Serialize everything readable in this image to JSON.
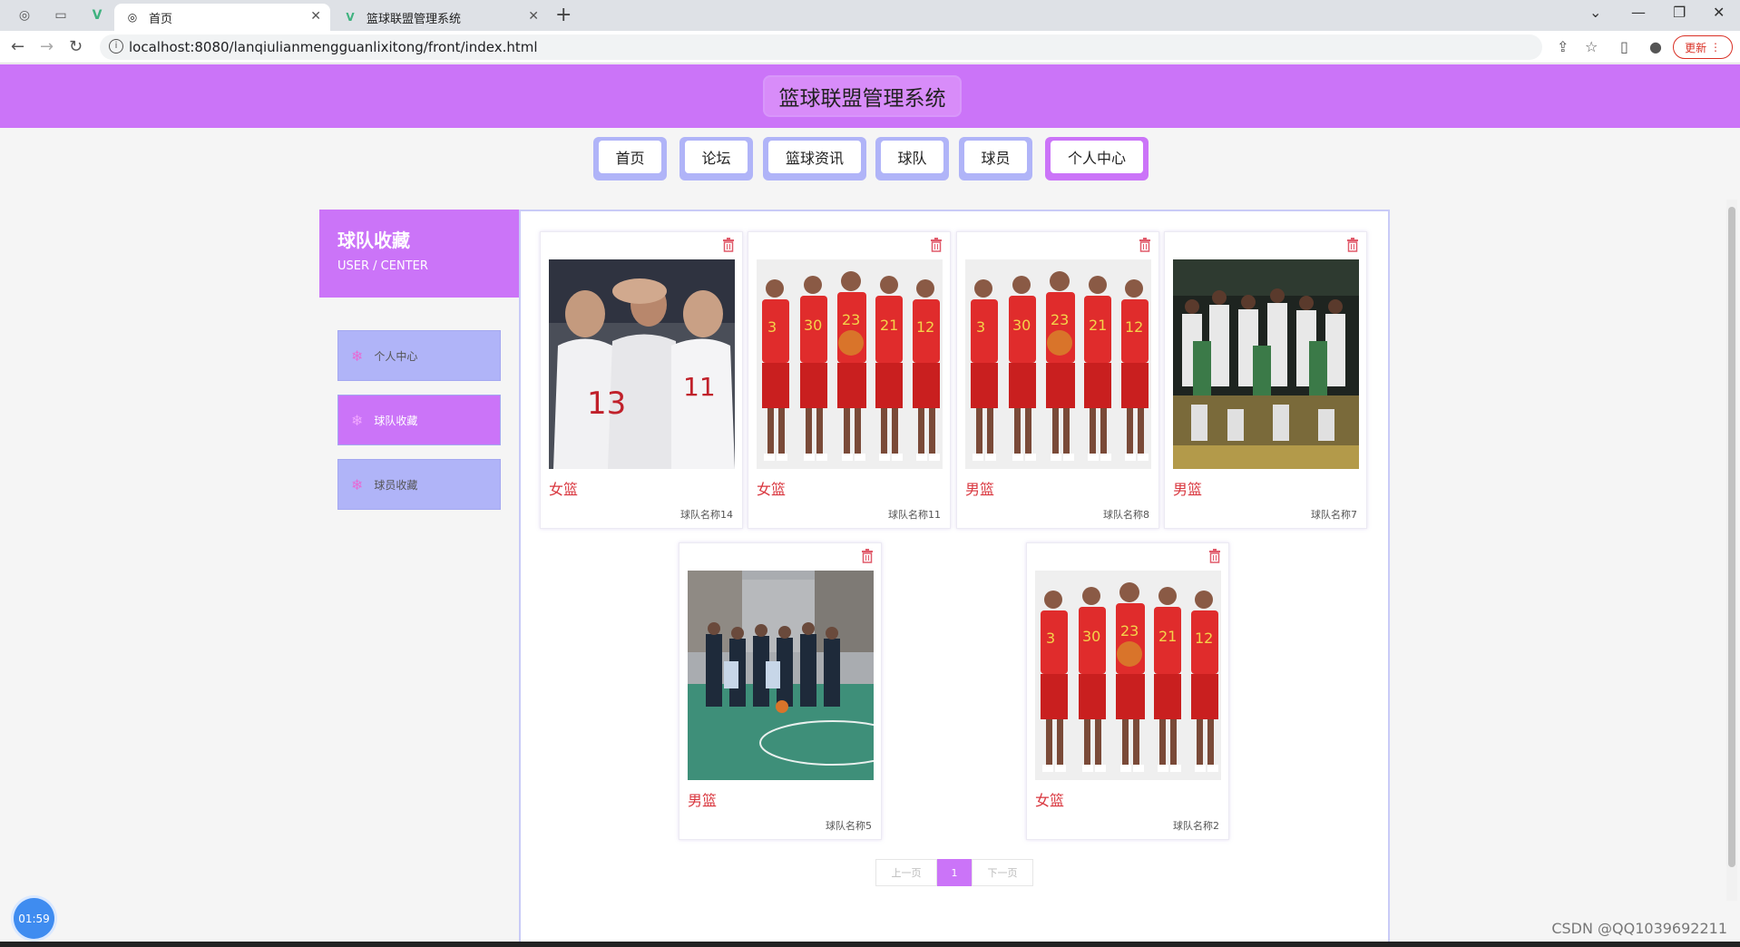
{
  "browser": {
    "tabs": [
      {
        "title": "首页",
        "favicon": "globe-icon",
        "active": true
      },
      {
        "title": "篮球联盟管理系统",
        "favicon": "vue-logo-icon",
        "active": false
      }
    ],
    "url": "localhost:8080/lanqiulianmengguanlixitong/front/index.html",
    "update_label": "更新"
  },
  "site": {
    "title": "篮球联盟管理系统",
    "nav": [
      {
        "label": "首页",
        "active": false
      },
      {
        "label": "论坛",
        "active": false
      },
      {
        "label": "篮球资讯",
        "active": false
      },
      {
        "label": "球队",
        "active": false
      },
      {
        "label": "球员",
        "active": false
      },
      {
        "label": "个人中心",
        "active": true
      }
    ]
  },
  "sidebar": {
    "title": "球队收藏",
    "subtitle": "USER / CENTER",
    "items": [
      {
        "label": "个人中心",
        "active": false
      },
      {
        "label": "球队收藏",
        "active": true
      },
      {
        "label": "球员收藏",
        "active": false
      }
    ]
  },
  "cards": [
    {
      "tag": "女篮",
      "name": "球队名称14",
      "photo": "team-huddle"
    },
    {
      "tag": "女篮",
      "name": "球队名称11",
      "photo": "red-team-lineup"
    },
    {
      "tag": "男篮",
      "name": "球队名称8",
      "photo": "red-team-lineup"
    },
    {
      "tag": "男篮",
      "name": "球队名称7",
      "photo": "championship-celebration"
    },
    {
      "tag": "男篮",
      "name": "球队名称5",
      "photo": "outdoor-court-group"
    },
    {
      "tag": "女篮",
      "name": "球队名称2",
      "photo": "red-team-lineup"
    }
  ],
  "pager": {
    "prev": "上一页",
    "current": "1",
    "next": "下一页"
  },
  "timer": "01:59",
  "watermark": "CSDN @QQ1039692211",
  "colors": {
    "primary": "#cb74f8",
    "secondary": "#b0b4f8",
    "tag": "#d9363e"
  }
}
